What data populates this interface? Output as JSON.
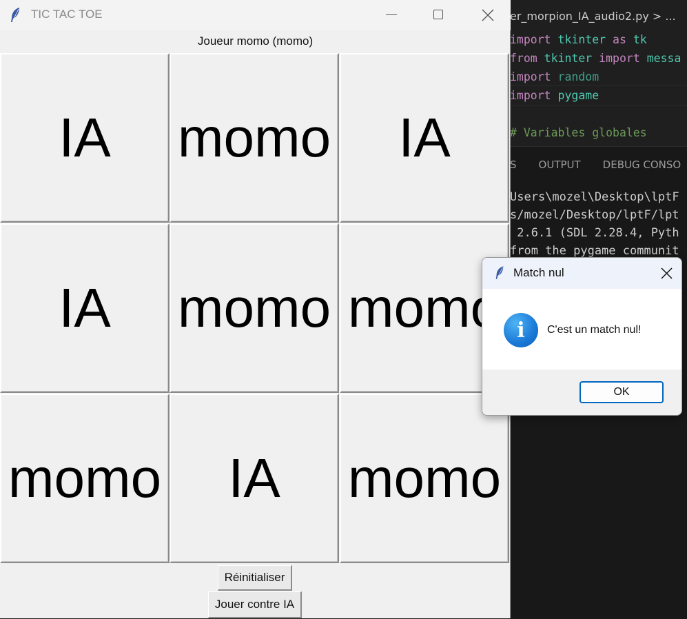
{
  "vscode": {
    "breadcrumb": "er_morpion_IA_audio2.py > ...",
    "code_lines": [
      [
        {
          "t": "import ",
          "c": "kw"
        },
        {
          "t": "tkinter",
          "c": "mod"
        },
        {
          "t": " as ",
          "c": "kw"
        },
        {
          "t": "tk",
          "c": "mod"
        }
      ],
      [
        {
          "t": "from ",
          "c": "kw"
        },
        {
          "t": "tkinter",
          "c": "mod"
        },
        {
          "t": " import ",
          "c": "kw"
        },
        {
          "t": "messa",
          "c": "mod"
        }
      ],
      [
        {
          "t": "import ",
          "c": "kw"
        },
        {
          "t": "random",
          "c": "mod2"
        }
      ],
      [
        {
          "t": "import ",
          "c": "kw"
        },
        {
          "t": "pygame",
          "c": "mod"
        }
      ],
      [
        {
          "t": "",
          "c": "plain"
        }
      ],
      [
        {
          "t": "# Variables globales",
          "c": "cm"
        }
      ]
    ],
    "panel_tabs": [
      "S",
      "OUTPUT",
      "DEBUG CONSO"
    ],
    "terminal_lines": [
      "Users\\mozel\\Desktop\\lptF",
      "s/mozel/Desktop/lptF/lpt",
      " 2.6.1 (SDL 2.28.4, Pyth",
      "from the pygame communit"
    ]
  },
  "window": {
    "title": "TIC TAC TOE",
    "player_label": "Joueur momo (momo)"
  },
  "board": {
    "cells": [
      "IA",
      "momo",
      "IA",
      "IA",
      "momo",
      "momo",
      "momo",
      "IA",
      "momo"
    ]
  },
  "buttons": {
    "reset": "Réinitialiser",
    "play_ai": "Jouer contre IA"
  },
  "dialog": {
    "title": "Match nul",
    "message": "C'est un match nul!",
    "ok": "OK",
    "accent": "#0067c0"
  }
}
